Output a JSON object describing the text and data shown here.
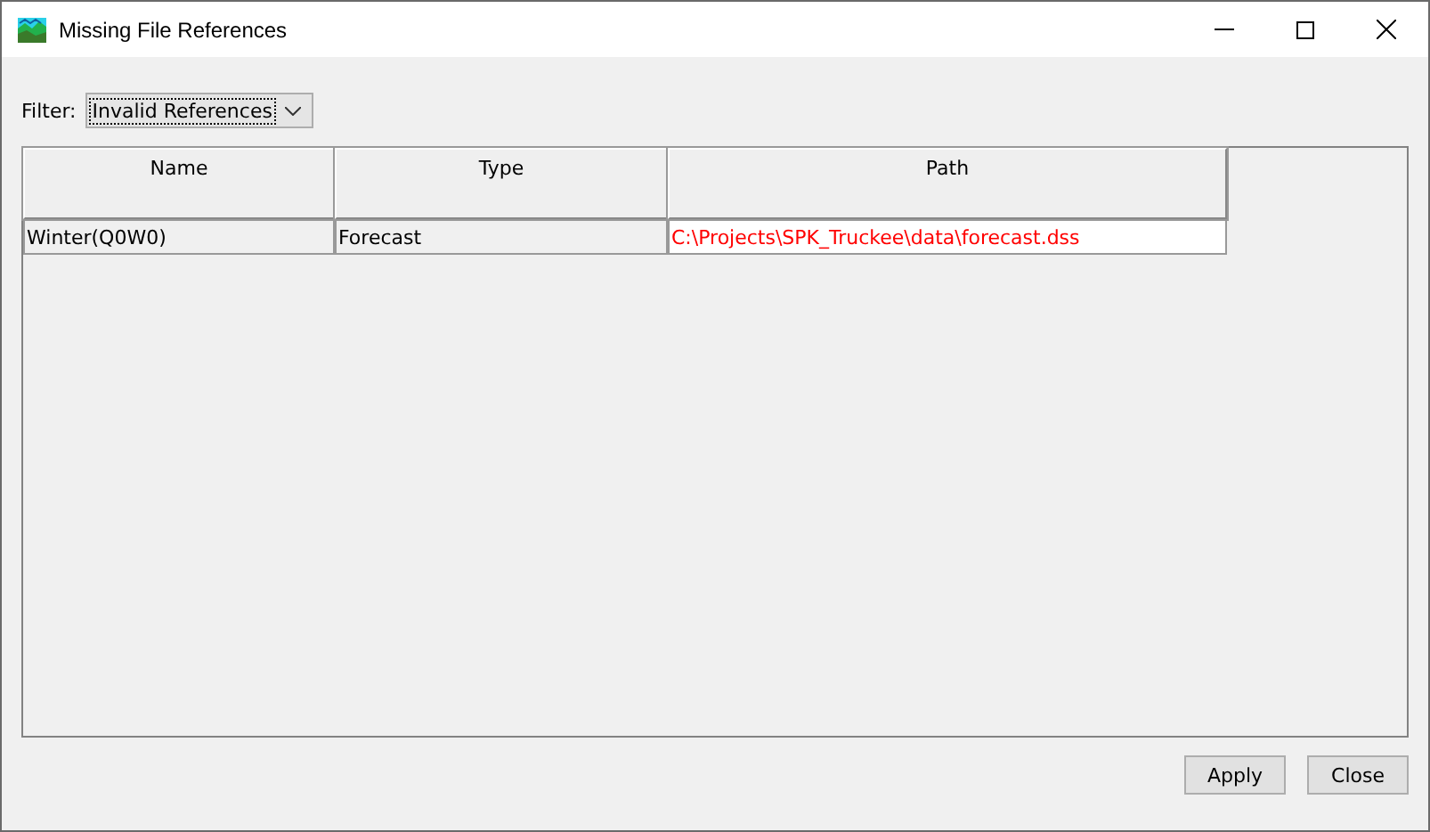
{
  "window": {
    "title": "Missing File References"
  },
  "filter": {
    "label": "Filter:",
    "value": "Invalid References"
  },
  "table": {
    "columns": [
      "Name",
      "Type",
      "Path"
    ],
    "rows": [
      {
        "name": "Winter(Q0W0)",
        "type": "Forecast",
        "path": "C:\\Projects\\SPK_Truckee\\data\\forecast.dss",
        "invalid": true
      }
    ]
  },
  "buttons": [
    "Apply",
    "Close"
  ]
}
